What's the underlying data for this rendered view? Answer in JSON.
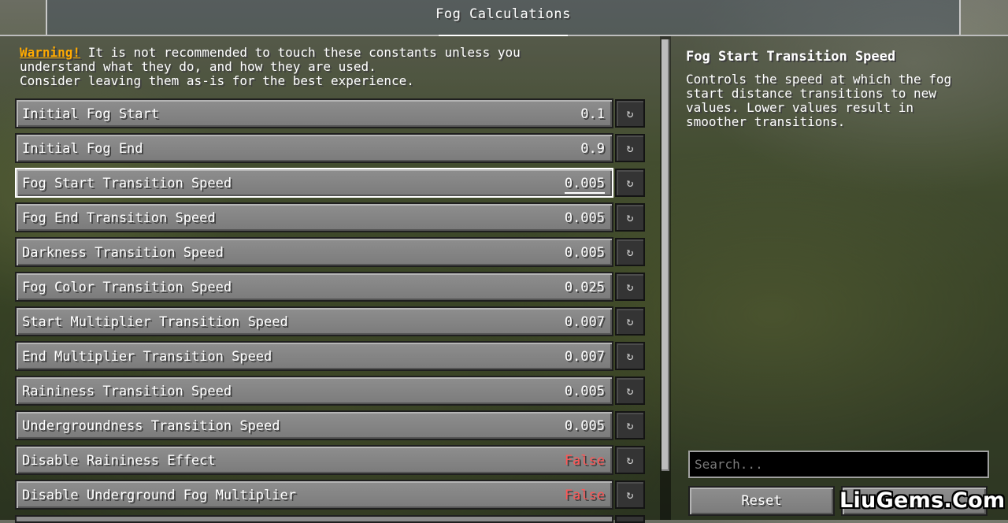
{
  "header": {
    "title": "Fog Calculations"
  },
  "warning": {
    "label": "Warning!",
    "line1_rest": " It is not recommended to touch these constants unless you",
    "line2": "understand what they do, and how they are used.",
    "line3": "Consider leaving them as-is for the best experience."
  },
  "options": [
    {
      "label": "Initial Fog Start",
      "value": "0.1"
    },
    {
      "label": "Initial Fog End",
      "value": "0.9"
    },
    {
      "label": "Fog Start Transition Speed",
      "value": "0.005"
    },
    {
      "label": "Fog End Transition Speed",
      "value": "0.005"
    },
    {
      "label": "Darkness Transition Speed",
      "value": "0.005"
    },
    {
      "label": "Fog Color Transition Speed",
      "value": "0.025"
    },
    {
      "label": "Start Multiplier Transition Speed",
      "value": "0.007"
    },
    {
      "label": "End Multiplier Transition Speed",
      "value": "0.007"
    },
    {
      "label": "Raininess Transition Speed",
      "value": "0.005"
    },
    {
      "label": "Undergroundness Transition Speed",
      "value": "0.005"
    },
    {
      "label": "Disable Raininess Effect",
      "value": "False"
    },
    {
      "label": "Disable Underground Fog Multiplier",
      "value": "False"
    }
  ],
  "selected_option_index": 2,
  "reset_icon_glyph": "↻",
  "description": {
    "title": "Fog Start Transition Speed",
    "line1": "Controls the speed at which the fog",
    "line2": "start distance transitions to new",
    "line3": "values. Lower values result in",
    "line4": "smoother transitions."
  },
  "search": {
    "placeholder": "Search..."
  },
  "buttons": {
    "reset_label": "Reset",
    "done_label": "Undo"
  },
  "watermark": {
    "text": "LiuGems.Com"
  },
  "colors": {
    "warning_accent": "#ffaa00",
    "false_value": "#ff5555",
    "text": "#ffffff"
  }
}
